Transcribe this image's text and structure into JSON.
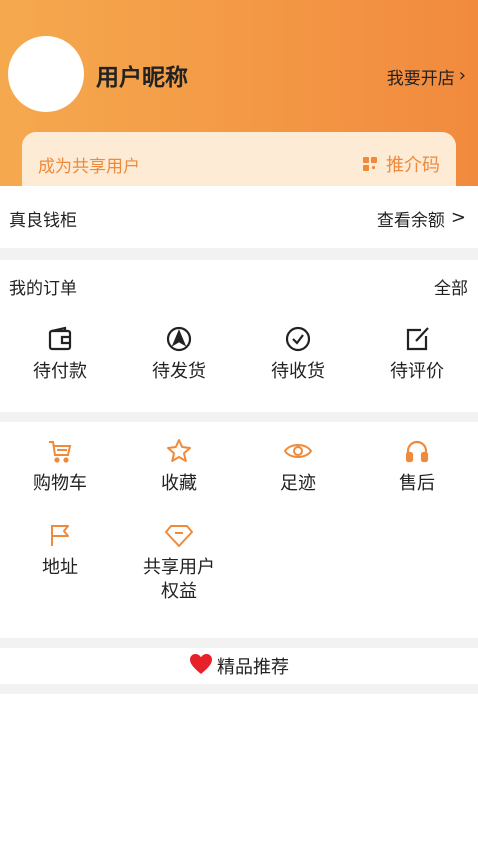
{
  "profile": {
    "nickname": "用户昵称",
    "open_shop": "我要开店",
    "chevron": "›"
  },
  "share_card": {
    "title": "成为共享用户",
    "promo_label": "推介码",
    "promo_icon": "qr-code-icon"
  },
  "wallet": {
    "label": "真良钱柜",
    "action": "查看余额",
    "chevron": ">"
  },
  "orders": {
    "title": "我的订单",
    "all_label": "全部",
    "items": [
      {
        "label": "待付款",
        "icon": "wallet-icon"
      },
      {
        "label": "待发货",
        "icon": "send-icon"
      },
      {
        "label": "待收货",
        "icon": "check-circle-icon"
      },
      {
        "label": "待评价",
        "icon": "edit-icon"
      }
    ]
  },
  "services": {
    "items": [
      {
        "label": "购物车",
        "icon": "cart-icon"
      },
      {
        "label": "收藏",
        "icon": "star-icon"
      },
      {
        "label": "足迹",
        "icon": "eye-icon"
      },
      {
        "label": "售后",
        "icon": "headphones-icon"
      },
      {
        "label": "地址",
        "icon": "flag-icon"
      },
      {
        "label_line1": "共享用户",
        "label_line2": "权益",
        "icon": "diamond-icon"
      }
    ],
    "accent_color": "#f08a3b"
  },
  "recommend": {
    "label": "精品推荐",
    "icon": "heart-icon",
    "heart_color": "#e8202a"
  },
  "colors": {
    "header_start": "#f5a94e",
    "header_end": "#f28a3e",
    "card_bg": "#fdebd6",
    "accent": "#f08a3b"
  }
}
